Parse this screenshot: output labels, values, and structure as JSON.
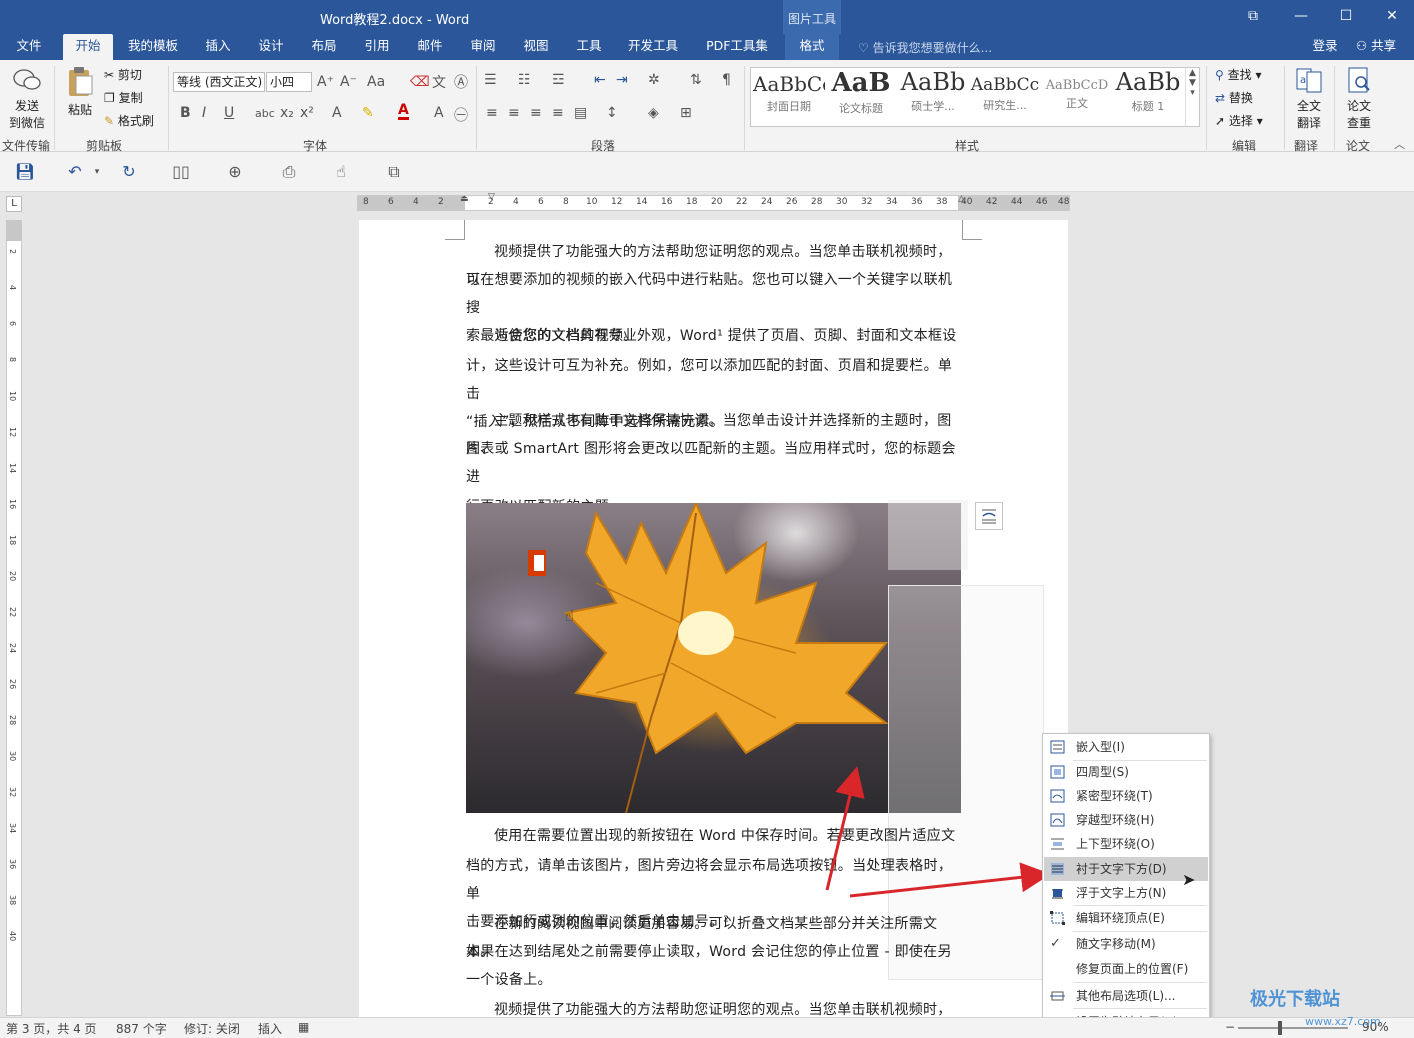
{
  "window": {
    "title": "Word教程2.docx - Word",
    "context_tools": "图片工具",
    "min": "—",
    "restore": "☐",
    "close": "✕",
    "ribbon_toggle": "⧉"
  },
  "tabs": [
    "文件",
    "开始",
    "我的模板",
    "插入",
    "设计",
    "布局",
    "引用",
    "邮件",
    "审阅",
    "视图",
    "工具",
    "开发工具",
    "PDF工具集",
    "格式"
  ],
  "tell_me": "告诉我您想要做什么...",
  "account": {
    "login": "登录",
    "share": "共享"
  },
  "ribbon": {
    "file_transfer": {
      "label": "发送\n到微信",
      "group": "文件传输",
      "l1": "发送",
      "l2": "到微信"
    },
    "clipboard": {
      "paste": "粘贴",
      "cut": "剪切",
      "copy": "复制",
      "format_painter": "格式刷",
      "group": "剪贴板"
    },
    "font": {
      "name": "等线 (西文正文)",
      "size": "小四",
      "group": "字体"
    },
    "paragraph": {
      "group": "段落"
    },
    "styles": {
      "group": "样式",
      "items": [
        {
          "preview": "AaBbCc",
          "name": "封面日期"
        },
        {
          "preview": "AaB",
          "name": "论文标题"
        },
        {
          "preview": "AaBb",
          "name": "硕士学..."
        },
        {
          "preview": "AaBbCc",
          "name": "研究生..."
        },
        {
          "preview": "AaBbCcD",
          "name": "正文"
        },
        {
          "preview": "AaBb",
          "name": "标题 1"
        }
      ]
    },
    "editing": {
      "find": "查找",
      "replace": "替换",
      "select": "选择",
      "group": "编辑"
    },
    "translate": {
      "l1": "全文",
      "l2": "翻译",
      "group": "翻译"
    },
    "paper": {
      "l1": "论文",
      "l2": "查重",
      "group": "论文"
    }
  },
  "ruler": {
    "h_left": [
      "8",
      "6",
      "4",
      "2"
    ],
    "h_right": [
      "2",
      "4",
      "6",
      "8",
      "10",
      "12",
      "14",
      "16",
      "18",
      "20",
      "22",
      "24",
      "26",
      "28",
      "30",
      "32",
      "34",
      "36",
      "38",
      "40",
      "42",
      "44",
      "46",
      "48"
    ],
    "v": [
      "2",
      "4",
      "6",
      "8",
      "10",
      "12",
      "14",
      "16",
      "18",
      "20",
      "22",
      "24",
      "26",
      "28",
      "30",
      "32",
      "34",
      "36",
      "38",
      "40"
    ],
    "corner": "L"
  },
  "document": {
    "p1": [
      "视频提供了功能强大的方法帮助您证明您的观点。当您单击联机视频时，可",
      "以在想要添加的视频的嵌入代码中进行粘贴。您也可以键入一个关键字以联机搜",
      "索最适合您的文档的视频。"
    ],
    "p2": [
      "为使您的文档具有专业外观，Word¹ 提供了页眉、页脚、封面和文本框设",
      "计，这些设计可互为补充。例如，您可以添加匹配的封面、页眉和提要栏。单击",
      "“插入”，然后从不同库中选择所需元素。"
    ],
    "p3": [
      "主题和样式也有助于文档保持协调。当您单击设计并选择新的主题时，图片、",
      "图表或 SmartArt 图形将会更改以匹配新的主题。当应用样式时，您的标题会进",
      "行更改以匹配新的主题。"
    ],
    "p4": [
      "使用在需要位置出现的新按钮在 Word 中保存时间。若要更改图片适应文",
      "档的方式，请单击该图片，图片旁边将会显示布局选项按钮。当处理表格时，单",
      "击要添加行或列的位置，然后单击加号。²"
    ],
    "p5": [
      "在新的阅读视图中阅读更加容易。可以折叠文档某些部分并关注所需文本。",
      "如果在达到结尾处之前需要停止读取，Word 会记住您的停止位置 - 即使在另",
      "一个设备上。"
    ],
    "p6": "视频提供了功能强大的方法帮助您证明您的观点。当您单击联机视频时，"
  },
  "context_menu": {
    "items": [
      {
        "label": "嵌入型(I)"
      },
      {
        "label": "四周型(S)"
      },
      {
        "label": "紧密型环绕(T)"
      },
      {
        "label": "穿越型环绕(H)"
      },
      {
        "label": "上下型环绕(O)"
      },
      {
        "label": "衬于文字下方(D)",
        "highlighted": true
      },
      {
        "label": "浮于文字上方(N)"
      },
      {
        "label": "编辑环绕顶点(E)"
      },
      {
        "label": "随文字移动(M)",
        "checked": true
      },
      {
        "label": "修复页面上的位置(F)"
      },
      {
        "label": "其他布局选项(L)..."
      },
      {
        "label": "设置为默认布局(A)"
      }
    ],
    "check": "✓"
  },
  "status_bar": {
    "page": "第 3 页，共 4 页",
    "words": "887 个字",
    "track": "修订: 关闭",
    "insert": "插入",
    "zoom": "90%"
  },
  "watermark": {
    "text": "极光下载站",
    "url": "www.xz7.com"
  },
  "colors": {
    "brand": "#2b579a",
    "annotation_arrow": "#d9262a"
  }
}
